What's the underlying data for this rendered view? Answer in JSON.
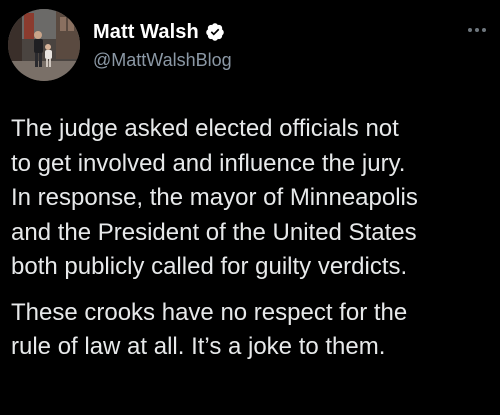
{
  "author": {
    "display_name": "Matt Walsh",
    "handle": "@MattWalshBlog",
    "verified": true
  },
  "icons": {
    "avatar": "profile-photo",
    "verified": "verified-badge-icon",
    "more": "more-options-icon"
  },
  "tweet": {
    "paragraphs": [
      "The judge asked elected officials not\nto get involved and influence the jury.\nIn response, the mayor of Minneapolis\nand the President of the United States\nboth publicly called for guilty verdicts.",
      "These crooks have no respect for the\nrule of law at all. It’s a joke to them."
    ]
  },
  "colors": {
    "background": "#000000",
    "text": "#e7e9ea",
    "secondary": "#8b98a5",
    "verified_badge": "#ffffff"
  }
}
